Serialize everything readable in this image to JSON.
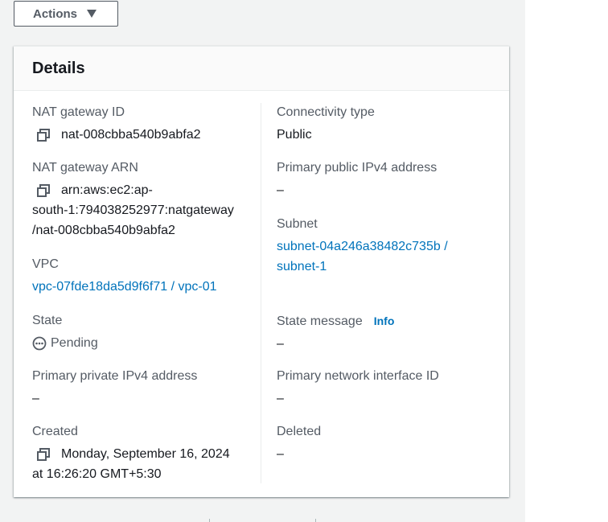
{
  "actions": {
    "label": "Actions"
  },
  "panel": {
    "title": "Details"
  },
  "fields": {
    "nat_gateway_id": {
      "label": "NAT gateway ID",
      "value": "nat-008cbba540b9abfa2"
    },
    "connectivity_type": {
      "label": "Connectivity type",
      "value": "Public"
    },
    "nat_gateway_arn": {
      "label": "NAT gateway ARN",
      "value_line1": "arn:aws:ec2:ap-",
      "value_line2": "south-1:794038252977:natgateway",
      "value_line3": "/nat-008cbba540b9abfa2"
    },
    "primary_public_ipv4": {
      "label": "Primary public IPv4 address",
      "value": "–"
    },
    "subnet": {
      "label": "Subnet",
      "value_line1": "subnet-04a246a38482c735b /",
      "value_line2": "subnet-1"
    },
    "vpc": {
      "label": "VPC",
      "value": "vpc-07fde18da5d9f6f71 / vpc-01"
    },
    "state": {
      "label": "State",
      "value": "Pending"
    },
    "state_message": {
      "label": "State message",
      "info": "Info",
      "value": "–"
    },
    "primary_private_ipv4": {
      "label": "Primary private IPv4 address",
      "value": "–"
    },
    "primary_network_interface": {
      "label": "Primary network interface ID",
      "value": "–"
    },
    "created": {
      "label": "Created",
      "value_line1": "Monday, September 16, 2024",
      "value_line2": "at 16:26:20 GMT+5:30"
    },
    "deleted": {
      "label": "Deleted",
      "value": "–"
    }
  },
  "colors": {
    "link": "#0073bb",
    "label": "#545b64",
    "text": "#16191f",
    "background": "#f2f3f3"
  }
}
